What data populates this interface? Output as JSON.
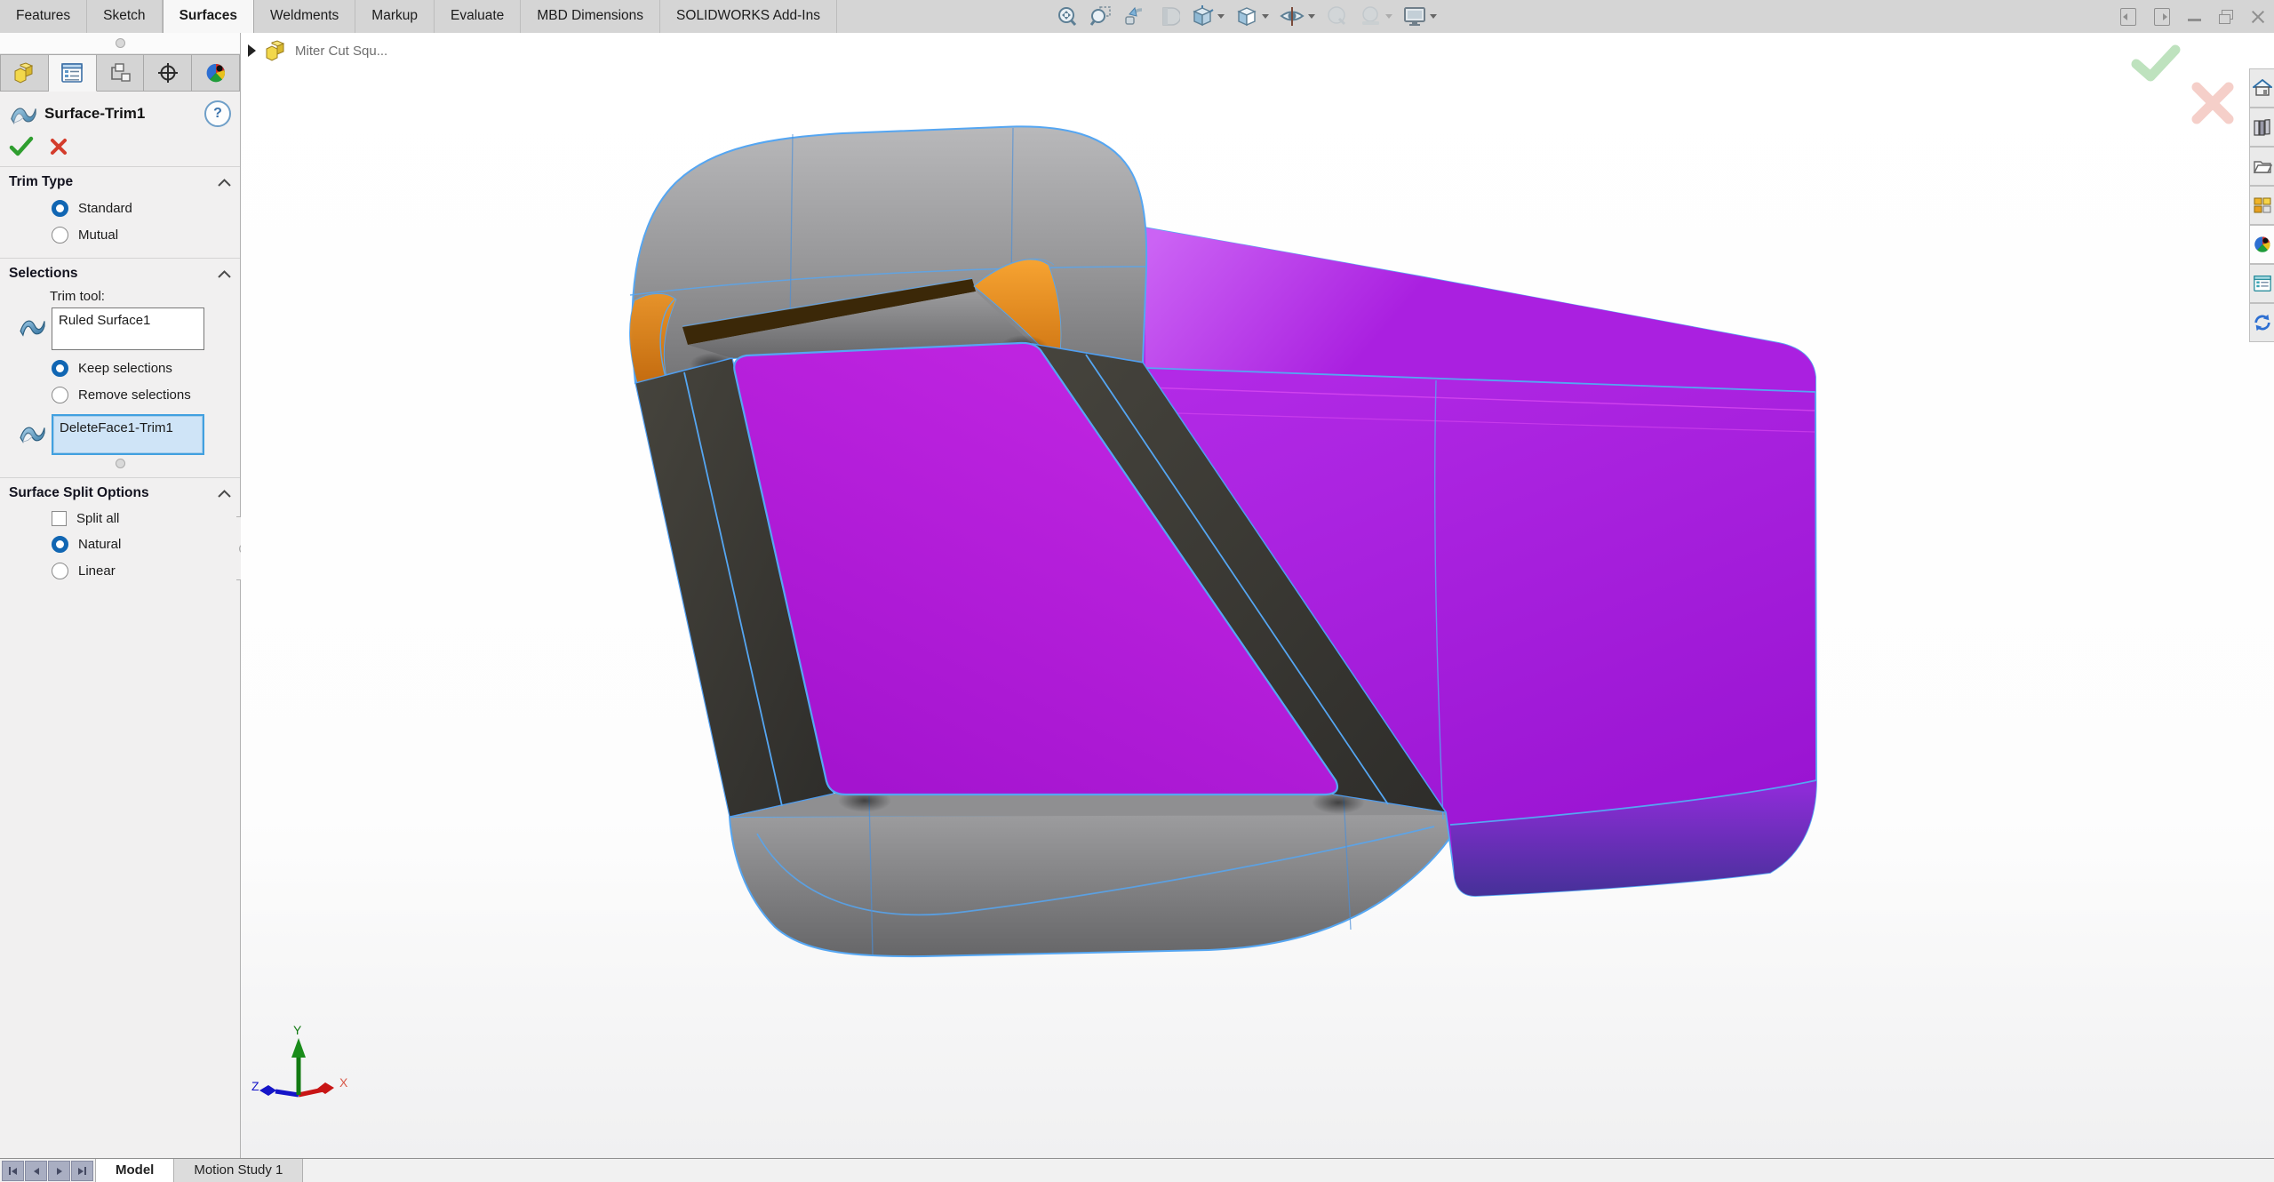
{
  "command_bar": {
    "tabs": [
      {
        "label": "Features",
        "active": false
      },
      {
        "label": "Sketch",
        "active": false
      },
      {
        "label": "Surfaces",
        "active": true
      },
      {
        "label": "Weldments",
        "active": false
      },
      {
        "label": "Markup",
        "active": false
      },
      {
        "label": "Evaluate",
        "active": false
      },
      {
        "label": "MBD Dimensions",
        "active": false
      },
      {
        "label": "SOLIDWORKS Add-Ins",
        "active": false
      }
    ]
  },
  "heads_up_toolbar": {
    "icons": [
      "zoom-to-fit",
      "zoom-to-area",
      "previous-view",
      "section-view",
      "view-orientation",
      "display-style",
      "hide-show-items",
      "edit-appearance",
      "apply-scene",
      "view-settings"
    ],
    "disabled": [
      "section-view",
      "edit-appearance",
      "apply-scene"
    ]
  },
  "window_controls": [
    "collapse-left-pane",
    "collapse-right-pane",
    "minimize",
    "restore",
    "close"
  ],
  "property_manager": {
    "tabs": [
      "feature-manager-design-tree",
      "property-manager",
      "configuration-manager",
      "dimxpert-manager",
      "display-manager"
    ],
    "active_tab_index": 1,
    "title": "Surface-Trim1",
    "help_label": "?",
    "trim_type": {
      "header": "Trim Type",
      "options": [
        {
          "label": "Standard",
          "selected": true
        },
        {
          "label": "Mutual",
          "selected": false
        }
      ]
    },
    "selections": {
      "header": "Selections",
      "trim_tool_label": "Trim tool:",
      "trim_tool_value": "Ruled Surface1",
      "mode_options": [
        {
          "label": "Keep selections",
          "selected": true
        },
        {
          "label": "Remove selections",
          "selected": false
        }
      ],
      "keep_list_value": "DeleteFace1-Trim1"
    },
    "surface_split": {
      "header": "Surface Split Options",
      "checkbox": {
        "label": "Split all",
        "checked": false
      },
      "options": [
        {
          "label": "Natural",
          "selected": true
        },
        {
          "label": "Linear",
          "selected": false
        }
      ]
    }
  },
  "viewport": {
    "flyout_label": "Miter Cut Squ...",
    "confirmation_corner": [
      "confirm-ok",
      "confirm-cancel"
    ],
    "triad": {
      "x_label": "X",
      "y_label": "Y",
      "z_label": "Z"
    }
  },
  "task_pane": {
    "icons": [
      "home",
      "design-library",
      "file-explorer",
      "view-palette",
      "appearances-scenes",
      "custom-properties",
      "solidworks-forum"
    ],
    "active": "appearances-scenes"
  },
  "bottom_bar": {
    "nav": [
      "first",
      "previous",
      "next",
      "last"
    ],
    "tabs": [
      {
        "label": "Model",
        "active": true
      },
      {
        "label": "Motion Study 1",
        "active": false
      }
    ]
  },
  "colors": {
    "accent_blue": "#1166b3",
    "selection_fill": "#cfe4f7",
    "selection_border": "#41a0e0",
    "magenta_face": "#b119d6",
    "purple_surface": "#a81ee0",
    "orange_fillet": "#ef8f1f",
    "edge_highlight": "#55a6f2",
    "ok_green": "#2f9e2f",
    "cancel_red": "#d43c2c"
  }
}
